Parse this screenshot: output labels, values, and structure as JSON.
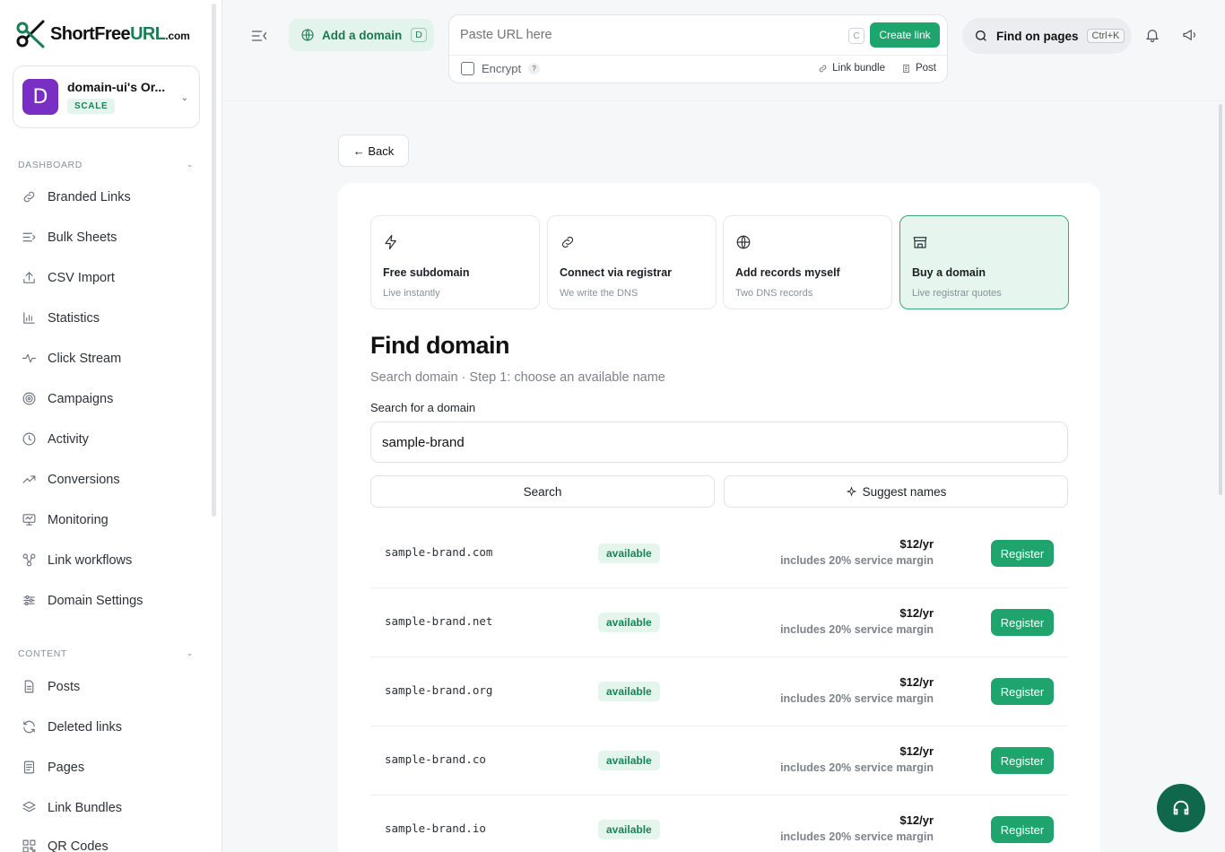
{
  "brand": {
    "name_prefix": "ShortFree",
    "name_highlight": "URL",
    "name_suffix": ".com"
  },
  "org": {
    "avatar_letter": "D",
    "name": "domain-ui's Or...",
    "plan": "SCALE"
  },
  "sidebar": {
    "dashboard_title": "DASHBOARD",
    "dashboard_items": [
      {
        "label": "Branded Links",
        "icon": "link-icon"
      },
      {
        "label": "Bulk Sheets",
        "icon": "list-icon"
      },
      {
        "label": "CSV Import",
        "icon": "upload-icon"
      },
      {
        "label": "Statistics",
        "icon": "bar-chart-icon"
      },
      {
        "label": "Click Stream",
        "icon": "activity-pulse-icon"
      },
      {
        "label": "Campaigns",
        "icon": "target-icon"
      },
      {
        "label": "Activity",
        "icon": "clock-icon"
      },
      {
        "label": "Conversions",
        "icon": "trending-up-icon"
      },
      {
        "label": "Monitoring",
        "icon": "monitor-icon"
      },
      {
        "label": "Link workflows",
        "icon": "workflow-icon"
      },
      {
        "label": "Domain Settings",
        "icon": "sliders-icon"
      }
    ],
    "content_title": "CONTENT",
    "content_items": [
      {
        "label": "Posts",
        "icon": "document-icon"
      },
      {
        "label": "Deleted links",
        "icon": "refresh-icon"
      },
      {
        "label": "Pages",
        "icon": "page-icon"
      },
      {
        "label": "Link Bundles",
        "icon": "layers-icon"
      },
      {
        "label": "QR Codes",
        "icon": "qr-icon"
      }
    ]
  },
  "topbar": {
    "add_domain_label": "Add a domain",
    "add_domain_key": "D",
    "url_placeholder": "Paste URL here",
    "url_key": "C",
    "create_link_label": "Create link",
    "encrypt_label": "Encrypt",
    "encrypt_help": "?",
    "link_bundle_label": "Link bundle",
    "post_label": "Post",
    "find_label": "Find on pages",
    "find_key": "Ctrl+K"
  },
  "main": {
    "back_label": "← Back",
    "options": [
      {
        "title": "Free subdomain",
        "subtitle": "Live instantly",
        "icon": "lightning-icon"
      },
      {
        "title": "Connect via registrar",
        "subtitle": "We write the DNS",
        "icon": "link-icon"
      },
      {
        "title": "Add records myself",
        "subtitle": "Two DNS records",
        "icon": "globe-icon"
      },
      {
        "title": "Buy a domain",
        "subtitle": "Live registrar quotes",
        "icon": "store-icon"
      }
    ],
    "active_option": 3,
    "heading": "Find domain",
    "subheading": "Search domain · Step 1: choose an available name",
    "search_label": "Search for a domain",
    "search_value": "sample-brand",
    "search_button": "Search",
    "suggest_button": "Suggest names",
    "results": [
      {
        "domain": "sample-brand.com",
        "status": "available",
        "price": "$12/yr",
        "note": "includes 20% service margin",
        "action": "Register"
      },
      {
        "domain": "sample-brand.net",
        "status": "available",
        "price": "$12/yr",
        "note": "includes 20% service margin",
        "action": "Register"
      },
      {
        "domain": "sample-brand.org",
        "status": "available",
        "price": "$12/yr",
        "note": "includes 20% service margin",
        "action": "Register"
      },
      {
        "domain": "sample-brand.co",
        "status": "available",
        "price": "$12/yr",
        "note": "includes 20% service margin",
        "action": "Register"
      },
      {
        "domain": "sample-brand.io",
        "status": "available",
        "price": "$12/yr",
        "note": "includes 20% service margin",
        "action": "Register"
      }
    ]
  },
  "colors": {
    "accent": "#1fa46e",
    "accent_dark": "#10684c",
    "accent_light": "#e3f4ec",
    "avatar": "#7a2fc4"
  }
}
